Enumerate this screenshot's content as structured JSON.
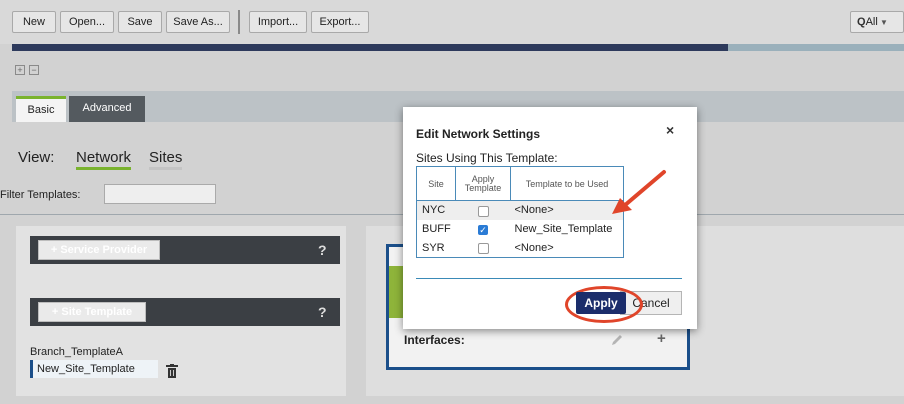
{
  "toolbar": {
    "new": "New",
    "open": "Open...",
    "save": "Save",
    "save_as": "Save As...",
    "import": "Import...",
    "export": "Export...",
    "search": "All"
  },
  "tabs": {
    "basic": "Basic",
    "advanced": "Advanced"
  },
  "view": {
    "label": "View:",
    "network": "Network",
    "sites": "Sites"
  },
  "filter": {
    "label": "Filter Templates:",
    "value": ""
  },
  "panels": {
    "service_provider": "+ Service Provider",
    "site_template": "+ Site Template",
    "help": "?",
    "templates": [
      "Branch_TemplateA",
      "New_Site_Template"
    ]
  },
  "right_panel": {
    "interfaces_label": "Interfaces:",
    "add": "+"
  },
  "dialog": {
    "title": "Edit Network Settings",
    "subtitle": "Sites Using This Template:",
    "close": "×",
    "columns": [
      "Site",
      "Apply Template",
      "Template to be Used"
    ],
    "rows": [
      {
        "site": "NYC",
        "checked": false,
        "template": "<None>"
      },
      {
        "site": "BUFF",
        "checked": true,
        "template": "New_Site_Template"
      },
      {
        "site": "SYR",
        "checked": false,
        "template": "<None>"
      }
    ],
    "apply": "Apply",
    "cancel": "Cancel"
  },
  "colors": {
    "accent_green": "#7ab32e",
    "navy": "#1b2d6b",
    "highlight_red": "#e0452a"
  }
}
